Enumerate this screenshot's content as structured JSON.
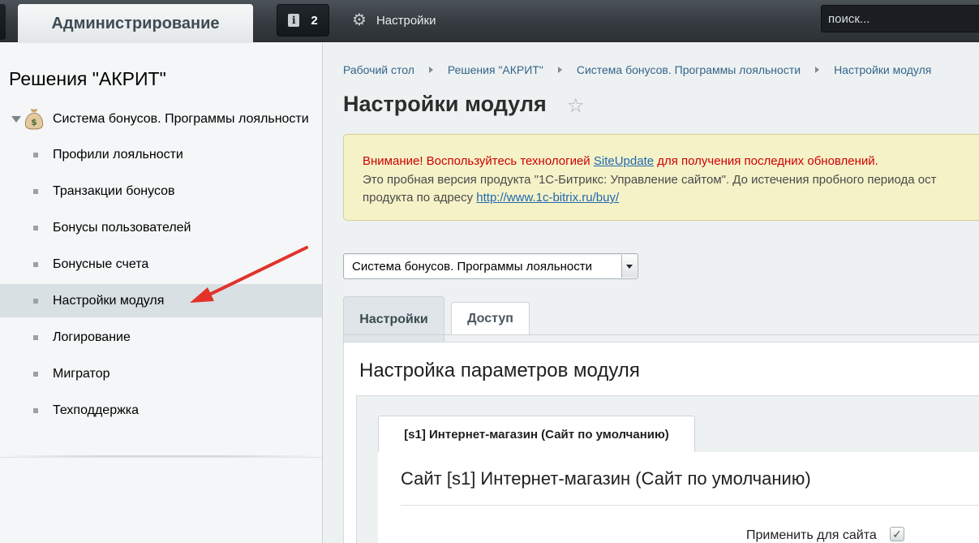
{
  "topbar": {
    "admin_tab": "Администрирование",
    "notifications_count": "2",
    "settings_label": "Настройки",
    "search_placeholder": "поиск..."
  },
  "sidebar": {
    "title": "Решения \"АКРИТ\"",
    "root_label": "Система бонусов. Программы лояльности",
    "items": [
      {
        "label": "Профили лояльности"
      },
      {
        "label": "Транзакции бонусов"
      },
      {
        "label": "Бонусы пользователей"
      },
      {
        "label": "Бонусные счета"
      },
      {
        "label": "Настройки модуля",
        "active": true
      },
      {
        "label": "Логирование"
      },
      {
        "label": "Мигратор"
      },
      {
        "label": "Техподдержка"
      }
    ]
  },
  "breadcrumb": [
    "Рабочий стол",
    "Решения \"АКРИТ\"",
    "Система бонусов. Программы лояльности",
    "Настройки модуля"
  ],
  "page_title": "Настройки модуля",
  "alert": {
    "warn_prefix": "Внимание!",
    "warn_text": " Воспользуйтесь технологией ",
    "warn_link": "SiteUpdate",
    "warn_suffix": " для получения последних обновлений.",
    "line2": "Это пробная версия продукта \"1С-Битрикс: Управление сайтом\". До истечения пробного периода ост",
    "line3_prefix": "продукта по адресу ",
    "line3_link": "http://www.1c-bitrix.ru/buy/"
  },
  "module_select": {
    "value": "Система бонусов. Программы лояльности"
  },
  "tabs": [
    {
      "label": "Настройки",
      "active": true
    },
    {
      "label": "Доступ",
      "active": false
    }
  ],
  "section_title": "Настройка параметров модуля",
  "site_tab_label": "[s1] Интернет-магазин (Сайт по умолчанию)",
  "site_title": "Сайт [s1] Интернет-магазин (Сайт по умолчанию)",
  "apply_label": "Применить для сайта",
  "apply_checked": true,
  "icons": {
    "notification": "info-icon",
    "settings": "gear-icon",
    "favorite": "star-icon",
    "module": "money-bag-icon",
    "annotation": "red-arrow-icon"
  },
  "colors": {
    "link": "#33658a",
    "warning": "#cf0000",
    "alert_bg": "#f5f2c8",
    "annotation": "#e2322a"
  }
}
